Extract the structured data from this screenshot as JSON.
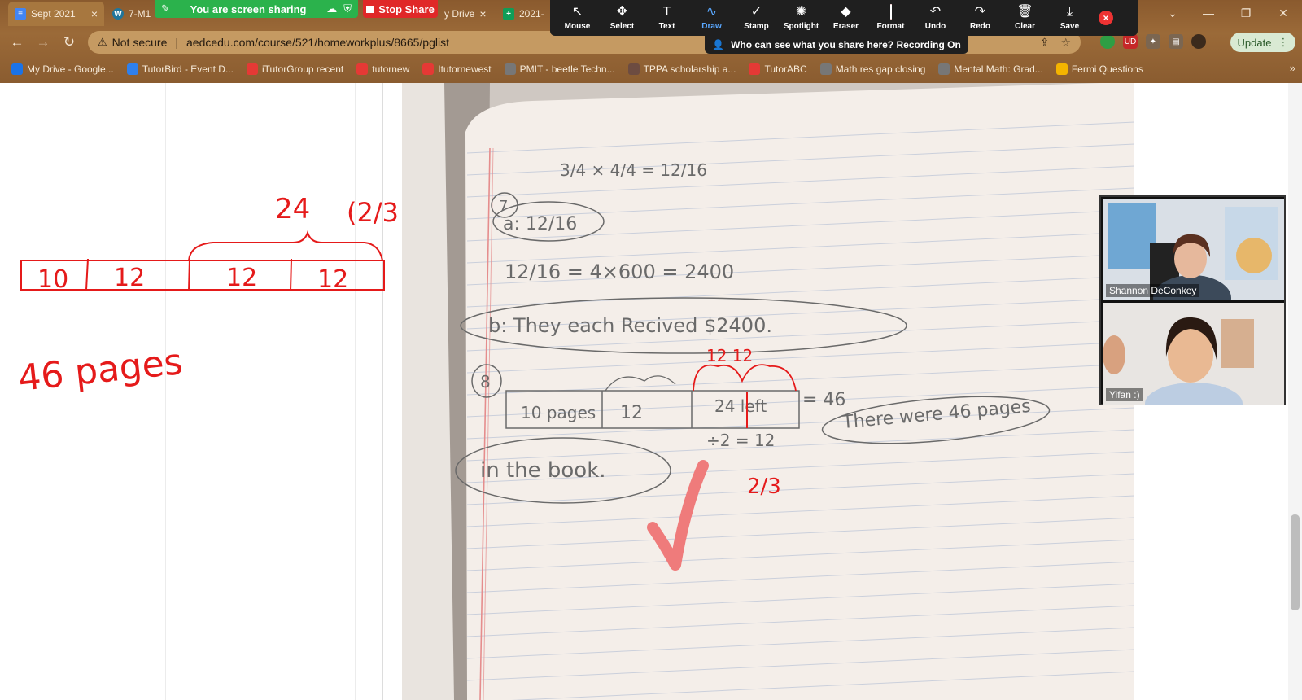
{
  "tabs": [
    {
      "title": "Sept 2021",
      "icon": "docs-icon",
      "color": "#4285f4"
    },
    {
      "title": "7-M1",
      "icon": "wordpress-icon",
      "color": "#21759b"
    },
    {
      "title": "y Drive",
      "icon": "drive-icon",
      "color": "#1a73e8"
    },
    {
      "title": "2021-",
      "icon": "sheets-icon",
      "color": "#0f9d58"
    }
  ],
  "share": {
    "banner_label": "You are screen sharing",
    "stop_label": "Stop Share"
  },
  "toolbar": {
    "tools": [
      {
        "label": "Mouse",
        "icon": "cursor-icon",
        "glyph": "↖"
      },
      {
        "label": "Select",
        "icon": "move-icon",
        "glyph": "✥"
      },
      {
        "label": "Text",
        "icon": "text-icon",
        "glyph": "T"
      },
      {
        "label": "Draw",
        "icon": "draw-icon",
        "glyph": "∿",
        "active": true
      },
      {
        "label": "Stamp",
        "icon": "stamp-icon",
        "glyph": "✓"
      },
      {
        "label": "Spotlight",
        "icon": "spotlight-icon",
        "glyph": "✺"
      },
      {
        "label": "Eraser",
        "icon": "eraser-icon",
        "glyph": "◆"
      },
      {
        "label": "Format",
        "icon": "format-icon",
        "glyph": ""
      },
      {
        "label": "Undo",
        "icon": "undo-icon",
        "glyph": "↶"
      },
      {
        "label": "Redo",
        "icon": "redo-icon",
        "glyph": "↷"
      },
      {
        "label": "Clear",
        "icon": "trash-icon",
        "glyph": "🗑"
      },
      {
        "label": "Save",
        "icon": "save-icon",
        "glyph": "⤓"
      }
    ],
    "format_color": "#ff2222",
    "recording_banner": "Who can see what you share here? Recording On"
  },
  "address": {
    "security": "Not secure",
    "url": "aedcedu.com/course/521/homeworkplus/8665/pglist"
  },
  "update_label": "Update",
  "bookmarks": [
    {
      "label": "My Drive - Google...",
      "icon": "drive-icon",
      "color": "#1a73e8"
    },
    {
      "label": "TutorBird - Event D...",
      "icon": "tutorbird-icon",
      "color": "#2f80ed"
    },
    {
      "label": "iTutorGroup recent",
      "icon": "itutor-icon",
      "color": "#e53935"
    },
    {
      "label": "tutornew",
      "icon": "itutor-icon",
      "color": "#e53935"
    },
    {
      "label": "Itutornewest",
      "icon": "itutor-icon",
      "color": "#e53935"
    },
    {
      "label": "PMIT - beetle Techn...",
      "icon": "globe-icon",
      "color": "#777777"
    },
    {
      "label": "TPPA scholarship a...",
      "icon": "tppa-icon",
      "color": "#6d4c41"
    },
    {
      "label": "TutorABC",
      "icon": "itutor-icon",
      "color": "#e53935"
    },
    {
      "label": "Math res gap closing",
      "icon": "globe-icon",
      "color": "#777777"
    },
    {
      "label": "Mental Math: Grad...",
      "icon": "globe-icon",
      "color": "#777777"
    },
    {
      "label": "Fermi Questions",
      "icon": "fermi-icon",
      "color": "#f4b400"
    }
  ],
  "whiteboard": {
    "bar_values": [
      "10",
      "12",
      "12",
      "12"
    ],
    "brace_label": "24",
    "brace_fraction": "(2/3)",
    "answer": "46 pages"
  },
  "notebook": {
    "line1": "3/4 × 4/4 = 12/16",
    "q7": "7",
    "a_label": "a: 12/16",
    "calc": "12/16 = 4×600 = 2400",
    "b_label": "b: They each Recived $2400.",
    "q8": "8",
    "bar_cells": [
      "10 pages",
      "12",
      "24 left"
    ],
    "equals": "= 46",
    "halves": "÷2 = 12",
    "top_twelves": "12   12",
    "statement_1": "There were 46 pages",
    "statement_2": "in the book.",
    "fraction_mark": "2/3"
  },
  "participants": [
    {
      "name": "Shannon DeConkey"
    },
    {
      "name": "Yifan :)"
    }
  ]
}
